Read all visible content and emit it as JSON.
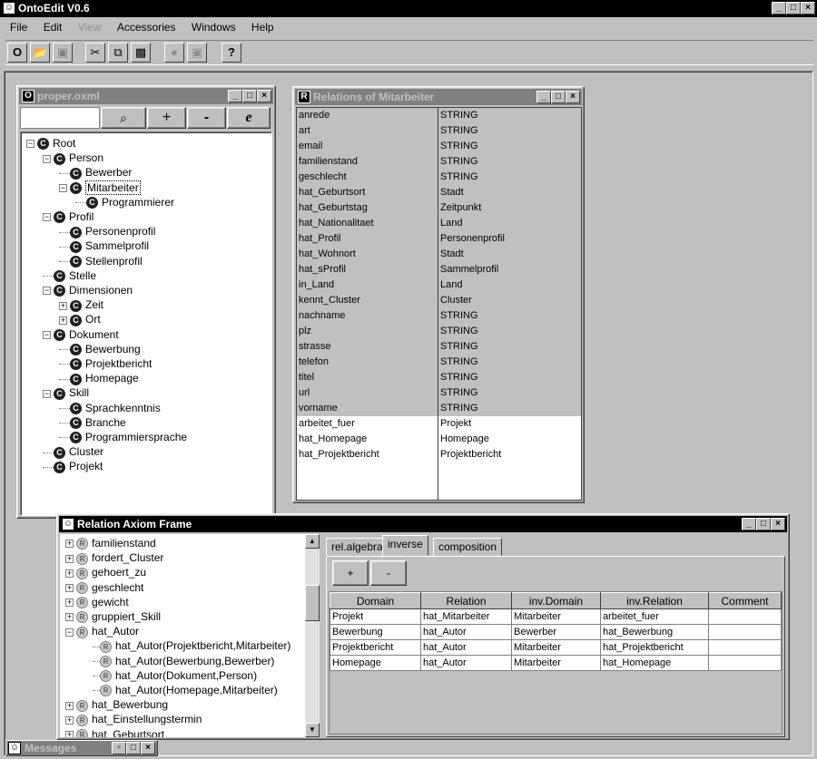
{
  "app": {
    "title": "OntoEdit V0.6",
    "menu": [
      {
        "label": "File",
        "disabled": false
      },
      {
        "label": "Edit",
        "disabled": false
      },
      {
        "label": "View",
        "disabled": true
      },
      {
        "label": "Accessories",
        "disabled": false
      },
      {
        "label": "Windows",
        "disabled": false
      },
      {
        "label": "Help",
        "disabled": false
      }
    ]
  },
  "toolbar": {
    "icons": [
      "ontology-icon",
      "open-folder-icon",
      "save-icon",
      "cut-icon",
      "copy-icon",
      "paste-icon",
      "circle-icon",
      "window-icon",
      "help-icon"
    ],
    "help_label": "?"
  },
  "proper": {
    "title": "proper.oxml",
    "search_value": "",
    "buttons": {
      "search": "⌕",
      "add": "+",
      "remove": "-",
      "edit": "e"
    },
    "tree": [
      {
        "label": "Root",
        "depth": 0,
        "toggle": "-"
      },
      {
        "label": "Person",
        "depth": 1,
        "toggle": "-"
      },
      {
        "label": "Bewerber",
        "depth": 2,
        "toggle": ""
      },
      {
        "label": "Mitarbeiter",
        "depth": 2,
        "toggle": "-",
        "selected": true
      },
      {
        "label": "Programmierer",
        "depth": 3,
        "toggle": ""
      },
      {
        "label": "Profil",
        "depth": 1,
        "toggle": "-"
      },
      {
        "label": "Personenprofil",
        "depth": 2,
        "toggle": ""
      },
      {
        "label": "Sammelprofil",
        "depth": 2,
        "toggle": ""
      },
      {
        "label": "Stellenprofil",
        "depth": 2,
        "toggle": ""
      },
      {
        "label": "Stelle",
        "depth": 1,
        "toggle": ""
      },
      {
        "label": "Dimensionen",
        "depth": 1,
        "toggle": "-"
      },
      {
        "label": "Zeit",
        "depth": 2,
        "toggle": "+"
      },
      {
        "label": "Ort",
        "depth": 2,
        "toggle": "+"
      },
      {
        "label": "Dokument",
        "depth": 1,
        "toggle": "-"
      },
      {
        "label": "Bewerbung",
        "depth": 2,
        "toggle": ""
      },
      {
        "label": "Projektbericht",
        "depth": 2,
        "toggle": ""
      },
      {
        "label": "Homepage",
        "depth": 2,
        "toggle": ""
      },
      {
        "label": "Skill",
        "depth": 1,
        "toggle": "-"
      },
      {
        "label": "Sprachkenntnis",
        "depth": 2,
        "toggle": ""
      },
      {
        "label": "Branche",
        "depth": 2,
        "toggle": ""
      },
      {
        "label": "Programmiersprache",
        "depth": 2,
        "toggle": ""
      },
      {
        "label": "Cluster",
        "depth": 1,
        "toggle": ""
      },
      {
        "label": "Projekt",
        "depth": 1,
        "toggle": ""
      }
    ]
  },
  "relations": {
    "title": "Relations of Mitarbeiter",
    "rows": [
      {
        "name": "anrede",
        "type": "STRING",
        "sel": true
      },
      {
        "name": "art",
        "type": "STRING",
        "sel": true
      },
      {
        "name": "email",
        "type": "STRING",
        "sel": true
      },
      {
        "name": "familienstand",
        "type": "STRING",
        "sel": true
      },
      {
        "name": "geschlecht",
        "type": "STRING",
        "sel": true
      },
      {
        "name": "hat_Geburtsort",
        "type": "Stadt",
        "sel": true
      },
      {
        "name": "hat_Geburtstag",
        "type": "Zeitpunkt",
        "sel": true
      },
      {
        "name": "hat_Nationalitaet",
        "type": "Land",
        "sel": true
      },
      {
        "name": "hat_Profil",
        "type": "Personenprofil",
        "sel": true
      },
      {
        "name": "hat_Wohnort",
        "type": "Stadt",
        "sel": true
      },
      {
        "name": "hat_sProfil",
        "type": "Sammelprofil",
        "sel": true
      },
      {
        "name": "in_Land",
        "type": "Land",
        "sel": true
      },
      {
        "name": "kennt_Cluster",
        "type": "Cluster",
        "sel": true
      },
      {
        "name": "nachname",
        "type": "STRING",
        "sel": true
      },
      {
        "name": "plz",
        "type": "STRING",
        "sel": true
      },
      {
        "name": "strasse",
        "type": "STRING",
        "sel": true
      },
      {
        "name": "telefon",
        "type": "STRING",
        "sel": true
      },
      {
        "name": "titel",
        "type": "STRING",
        "sel": true
      },
      {
        "name": "url",
        "type": "STRING",
        "sel": true
      },
      {
        "name": "vorname",
        "type": "STRING",
        "sel": true
      },
      {
        "name": "arbeitet_fuer",
        "type": "Projekt",
        "sel": false
      },
      {
        "name": "hat_Homepage",
        "type": "Homepage",
        "sel": false
      },
      {
        "name": "hat_Projektbericht",
        "type": "Projektbericht",
        "sel": false
      }
    ]
  },
  "axiom": {
    "title": "Relation Axiom Frame",
    "tree": [
      {
        "label": "familienstand",
        "toggle": "+",
        "depth": 0
      },
      {
        "label": "fordert_Cluster",
        "toggle": "+",
        "depth": 0
      },
      {
        "label": "gehoert_zu",
        "toggle": "+",
        "depth": 0
      },
      {
        "label": "geschlecht",
        "toggle": "+",
        "depth": 0
      },
      {
        "label": "gewicht",
        "toggle": "+",
        "depth": 0
      },
      {
        "label": "gruppiert_Skill",
        "toggle": "+",
        "depth": 0
      },
      {
        "label": "hat_Autor",
        "toggle": "-",
        "depth": 0
      },
      {
        "label": "hat_Autor(Projektbericht,Mitarbeiter)",
        "toggle": "",
        "depth": 1
      },
      {
        "label": "hat_Autor(Bewerbung,Bewerber)",
        "toggle": "",
        "depth": 1
      },
      {
        "label": "hat_Autor(Dokument,Person)",
        "toggle": "",
        "depth": 1
      },
      {
        "label": "hat_Autor(Homepage,Mitarbeiter)",
        "toggle": "",
        "depth": 1
      },
      {
        "label": "hat_Bewerbung",
        "toggle": "+",
        "depth": 0
      },
      {
        "label": "hat_Einstellungstermin",
        "toggle": "+",
        "depth": 0
      },
      {
        "label": "hat_Geburtsort",
        "toggle": "+",
        "depth": 0
      }
    ],
    "tabs": [
      "rel.algebra",
      "inverse",
      "composition"
    ],
    "active_tab": 1,
    "add_label": "+",
    "remove_label": "-",
    "columns": [
      "Domain",
      "Relation",
      "inv.Domain",
      "inv.Relation",
      "Comment"
    ],
    "rows": [
      [
        "Projekt",
        "hat_Mitarbeiter",
        "Mitarbeiter",
        "arbeitet_fuer",
        ""
      ],
      [
        "Bewerbung",
        "hat_Autor",
        "Bewerber",
        "hat_Bewerbung",
        ""
      ],
      [
        "Projektbericht",
        "hat_Autor",
        "Mitarbeiter",
        "hat_Projektbericht",
        ""
      ],
      [
        "Homepage",
        "hat_Autor",
        "Mitarbeiter",
        "hat_Homepage",
        ""
      ]
    ]
  },
  "messages": {
    "title": "Messages"
  }
}
